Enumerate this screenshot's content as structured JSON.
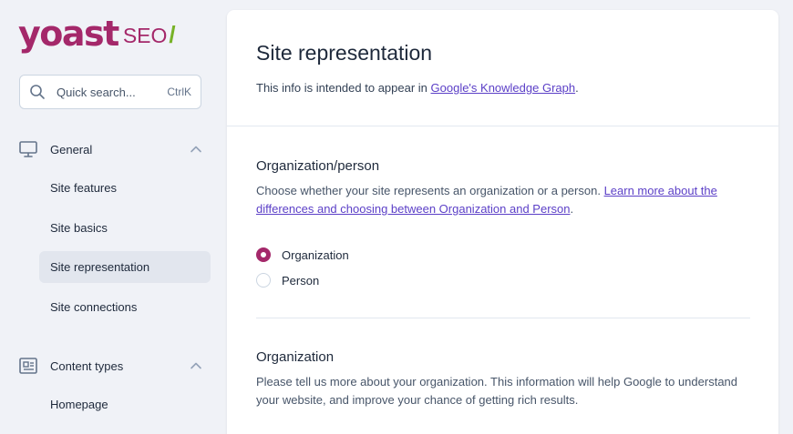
{
  "brand": {
    "name": "yoast",
    "product": "SEO",
    "slash": "/",
    "colors": {
      "primary": "#a4286a",
      "accent": "#77b227",
      "link": "#5b3fc7"
    }
  },
  "search": {
    "placeholder": "Quick search...",
    "shortcut": "CtrlK",
    "icon": "search-icon"
  },
  "sidebar": {
    "groups": [
      {
        "label": "General",
        "icon": "monitor-icon",
        "expanded": true,
        "items": [
          {
            "label": "Site features"
          },
          {
            "label": "Site basics"
          },
          {
            "label": "Site representation",
            "active": true
          },
          {
            "label": "Site connections"
          }
        ]
      },
      {
        "label": "Content types",
        "icon": "newspaper-icon",
        "expanded": true,
        "items": [
          {
            "label": "Homepage"
          }
        ]
      }
    ]
  },
  "main": {
    "title": "Site representation",
    "subtitle_prefix": "This info is intended to appear in ",
    "subtitle_link": "Google's Knowledge Graph",
    "subtitle_suffix": ".",
    "sections": [
      {
        "title": "Organization/person",
        "desc_prefix": "Choose whether your site represents an organization or a person. ",
        "desc_link": "Learn more about the differences and choosing between Organization and Person",
        "desc_suffix": ".",
        "options": [
          {
            "label": "Organization",
            "checked": true
          },
          {
            "label": "Person",
            "checked": false
          }
        ]
      },
      {
        "title": "Organization",
        "desc": "Please tell us more about your organization. This information will help Google to understand your website, and improve your chance of getting rich results."
      }
    ]
  }
}
